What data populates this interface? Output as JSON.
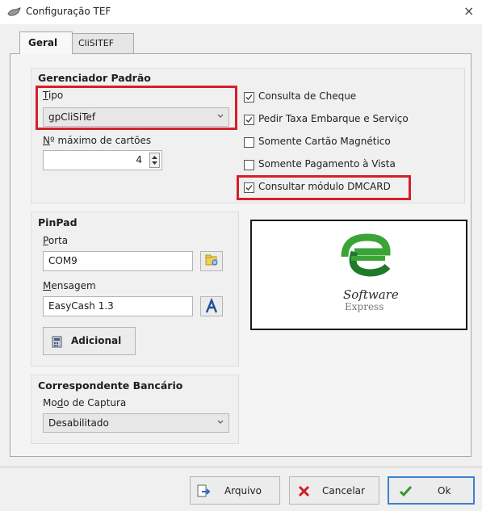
{
  "window": {
    "title": "Configuração TEF",
    "close_glyph": "×"
  },
  "tabs": [
    {
      "label": "Geral",
      "active": true
    },
    {
      "label": "CliSITEF",
      "active": false
    }
  ],
  "gerenciador": {
    "title": "Gerenciador Padrão",
    "tipo_label_first": "T",
    "tipo_label_rest": "ipo",
    "tipo_value": "gpCliSiTef",
    "max_cartoes_label_first": "N",
    "max_cartoes_label_rest": "º máximo de cartões",
    "max_cartoes_value": "4"
  },
  "options": [
    {
      "label": "Consulta de Cheque",
      "checked": true
    },
    {
      "label": "Pedir Taxa Embarque e Serviço",
      "checked": true
    },
    {
      "label": "Somente Cartão Magnético",
      "checked": false
    },
    {
      "label": "Somente Pagamento à Vista",
      "checked": false
    },
    {
      "label": "Consultar módulo DMCARD",
      "checked": true
    }
  ],
  "pinpad": {
    "title": "PinPad",
    "porta_label_first": "P",
    "porta_label_rest": "orta",
    "porta_value": "COM9",
    "mensagem_label_first": "M",
    "mensagem_label_rest": "ensagem",
    "mensagem_value": "EasyCash 1.3",
    "adicional_label": "Adicional"
  },
  "logo": {
    "line1": "Software",
    "line2": "Express",
    "colors": {
      "green": "#3aa536",
      "green_dark": "#1f7a2a"
    }
  },
  "correspondente": {
    "title": "Correspondente Bancário",
    "modo_label_a": "Mo",
    "modo_label_u": "d",
    "modo_label_b": "o de Captura",
    "modo_value": "Desabilitado"
  },
  "footer": {
    "arquivo": "Arquivo",
    "cancelar": "Cancelar",
    "ok": "Ok"
  },
  "colors": {
    "highlight_red": "#d4202a",
    "ok_green": "#2e9a2e",
    "cancel_red": "#d42020",
    "arquivo_blue": "#2b6cc4"
  }
}
